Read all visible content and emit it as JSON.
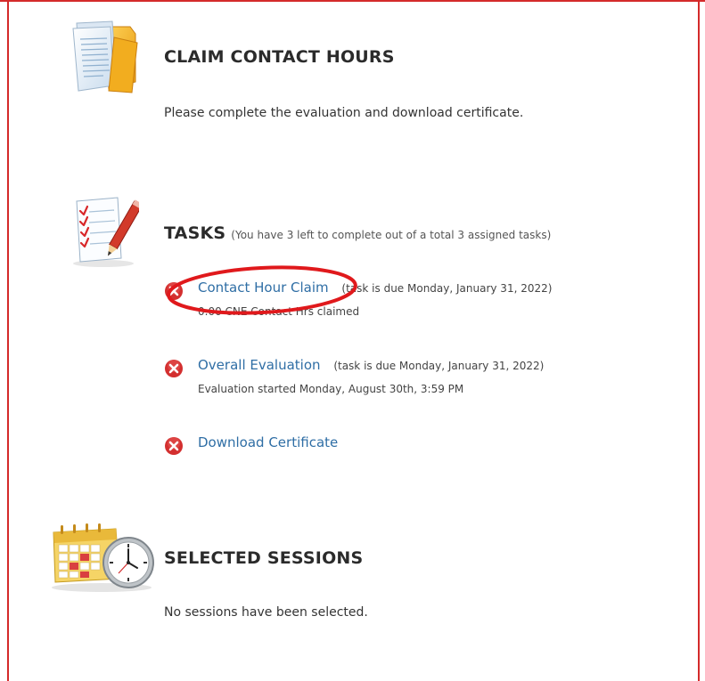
{
  "claim": {
    "heading": "CLAIM CONTACT HOURS",
    "message": "Please complete the evaluation and download certificate.",
    "icon": "documents-folder-icon"
  },
  "tasks": {
    "heading": "TASKS",
    "summary": "(You have 3 left to complete out of a total 3 assigned tasks)",
    "icon": "checklist-pencil-icon",
    "items": [
      {
        "label": "Contact Hour Claim",
        "due": "(task is due Monday, January 31, 2022)",
        "detail": "0.00 CNE Contact Hrs claimed",
        "status_icon": "incomplete-x-icon"
      },
      {
        "label": "Overall Evaluation",
        "due": "(task is due Monday, January 31, 2022)",
        "detail": "Evaluation started Monday, August 30th, 3:59 PM",
        "status_icon": "incomplete-x-icon"
      },
      {
        "label": "Download Certificate",
        "status_icon": "incomplete-x-icon"
      }
    ]
  },
  "sessions": {
    "heading": "SELECTED SESSIONS",
    "message": "No sessions have been selected.",
    "icon": "calendar-clock-icon"
  },
  "colors": {
    "link": "#2f6ea5",
    "incomplete": "#d32f2f",
    "annotation": "#e0191c",
    "frame": "#d42a2a"
  }
}
